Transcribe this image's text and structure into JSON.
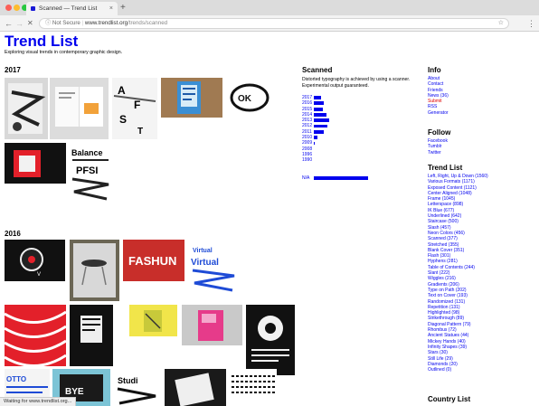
{
  "browser": {
    "tab_title": "Scanned — Trend List",
    "tab_close": "×",
    "new_tab": "+",
    "security": "Not Secure",
    "url_host": "www.trendlist.org",
    "url_path": "/trends/scanned",
    "status": "Waiting for www.trendlist.org..."
  },
  "site": {
    "title": "Trend List",
    "tagline": "Exploring visual trends in contemporary graphic design."
  },
  "sections": {
    "y2017": "2017",
    "y2016": "2016"
  },
  "scanned": {
    "heading": "Scanned",
    "description": "Distorted typography is achieved by using a scanner. Experimental output guaranteed.",
    "years": [
      {
        "label": "2017",
        "count": 6
      },
      {
        "label": "2016",
        "count": 8
      },
      {
        "label": "2015",
        "count": 7
      },
      {
        "label": "2014",
        "count": 10
      },
      {
        "label": "2013",
        "count": 12
      },
      {
        "label": "2012",
        "count": 11
      },
      {
        "label": "2011",
        "count": 8
      },
      {
        "label": "2010",
        "count": 3
      },
      {
        "label": "2009",
        "count": 1
      },
      {
        "label": "2008",
        "count": 0
      },
      {
        "label": "1996",
        "count": 0
      },
      {
        "label": "1990",
        "count": 0
      }
    ],
    "na_label": "N/A",
    "na_count": 43,
    "bar_color": "#0000ee"
  },
  "info": {
    "heading": "Info",
    "links": [
      "About",
      "Contact",
      "Friends",
      "News (36)",
      "Submit",
      "RSS",
      "Generator"
    ]
  },
  "follow": {
    "heading": "Follow",
    "links": [
      "Facebook",
      "Tumblr",
      "Twitter"
    ]
  },
  "trendlist": {
    "heading": "Trend List",
    "links": [
      "Left, Right, Up & Down (1560)",
      "Various Formats (1171)",
      "Exposed Content (1121)",
      "Center Aligned (1048)",
      "Frame (1045)",
      "Letterspace (898)",
      "IK Blue (677)",
      "Underlined (642)",
      "Staircase (500)",
      "Slash (457)",
      "Neon Colors (456)",
      "Scanned (377)",
      "Stretched (355)",
      "Blank Cover (351)",
      "Flash (301)",
      "Hyphens (281)",
      "Table of Contents (244)",
      "Slant (222)",
      "Wiggles (216)",
      "Gradients (206)",
      "Type on Path (202)",
      "Text on Cover (193)",
      "Randomized (131)",
      "Repetition (131)",
      "Highlighted (98)",
      "Strikethrough (89)",
      "Diagonal Pattern (79)",
      "Rhombus (72)",
      "Ancient Statues (44)",
      "Mickey Hands (40)",
      "Infinity Shapes (39)",
      "Stars (30)",
      "Still Life (29)",
      "Diamonds (20)",
      "Outlined (0)"
    ]
  },
  "countrylist": {
    "heading": "Country List"
  },
  "gallery_colors": {
    "accent": "#0000ee",
    "red": "#e3202a"
  }
}
